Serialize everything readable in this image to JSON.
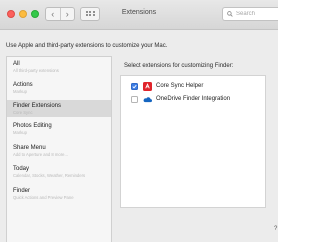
{
  "window": {
    "title": "Extensions",
    "search_placeholder": "Search"
  },
  "intro_text": "Use Apple and third-party extensions to customize your Mac.",
  "sidebar": {
    "items": [
      {
        "label": "All",
        "sub": "All third-party extensions"
      },
      {
        "label": "Actions",
        "sub": "Markup"
      },
      {
        "label": "Finder Extensions",
        "sub": "Core Sync"
      },
      {
        "label": "Photos Editing",
        "sub": "Markup"
      },
      {
        "label": "Share Menu",
        "sub": "Add to Aperture and 8 more..."
      },
      {
        "label": "Today",
        "sub": "Calendar, Stocks, Weather, Reminders"
      },
      {
        "label": "Finder",
        "sub": "Quick Actions and Preview Pane"
      }
    ]
  },
  "panel": {
    "prompt": "Select extensions for customizing Finder:",
    "extensions": [
      {
        "name": "Core Sync Helper",
        "checked": true,
        "icon": "adobe-core-sync-icon",
        "color": "#e0242b"
      },
      {
        "name": "OneDrive Finder Integration",
        "checked": false,
        "icon": "onedrive-cloud-icon",
        "color": "#1565c0"
      }
    ]
  },
  "colors": {
    "accent": "#3d7de4",
    "selected_bg": "#d9d9d9"
  }
}
